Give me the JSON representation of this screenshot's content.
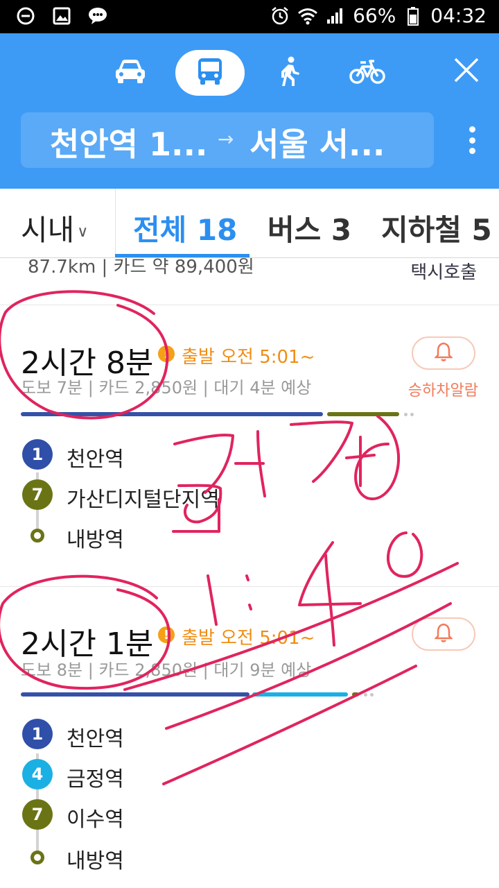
{
  "status_bar": {
    "battery": "66%",
    "time": "04:32"
  },
  "header": {
    "modes": [
      "car",
      "transit",
      "walk",
      "bike"
    ],
    "active_mode": "transit",
    "route_from": "천안역 1...",
    "route_arrow": "→",
    "route_to": "서울 서..."
  },
  "filters": {
    "city": "시내",
    "tabs": [
      {
        "label": "전체 18"
      },
      {
        "label": "버스 3"
      },
      {
        "label": "지하철 5"
      }
    ]
  },
  "previous_row": {
    "text": "87.7km  |  카드 약 89,400원",
    "right": "택시호출"
  },
  "routes": [
    {
      "duration": "2시간 8분",
      "depart": "출발 오전 5:01~",
      "meta": "도보 7분 | 카드 2,850원 | 대기 4분 예상",
      "alarm_label": "승하차알람",
      "stops": [
        {
          "badge": "1",
          "name": "천안역",
          "color": "#2f4fa8"
        },
        {
          "badge": "7",
          "name": "가산디지털단지역",
          "color": "#6b7415"
        },
        {
          "badge": "",
          "name": "내방역",
          "color": "#6b7415"
        }
      ]
    },
    {
      "duration": "2시간 1분",
      "depart": "출발 오전 5:01~",
      "meta": "도보 8분 | 카드 2,850원 | 대기 9분 예상",
      "stops": [
        {
          "badge": "1",
          "name": "천안역",
          "color": "#2f4fa8"
        },
        {
          "badge": "4",
          "name": "금정역",
          "color": "#1bb0e3"
        },
        {
          "badge": "7",
          "name": "이수역",
          "color": "#6b7415"
        },
        {
          "badge": "",
          "name": "내방역",
          "color": "#6b7415"
        }
      ]
    }
  ],
  "colors": {
    "header_blue": "#3d9bf5",
    "accent_blue": "#2b8ff0",
    "line1": "#2f4fa8",
    "line4": "#1bb0e3",
    "line7": "#6b7415",
    "depart_orange": "#f08c12",
    "alarm_red": "#f27a5a",
    "annotation_pink": "#e0245e"
  }
}
